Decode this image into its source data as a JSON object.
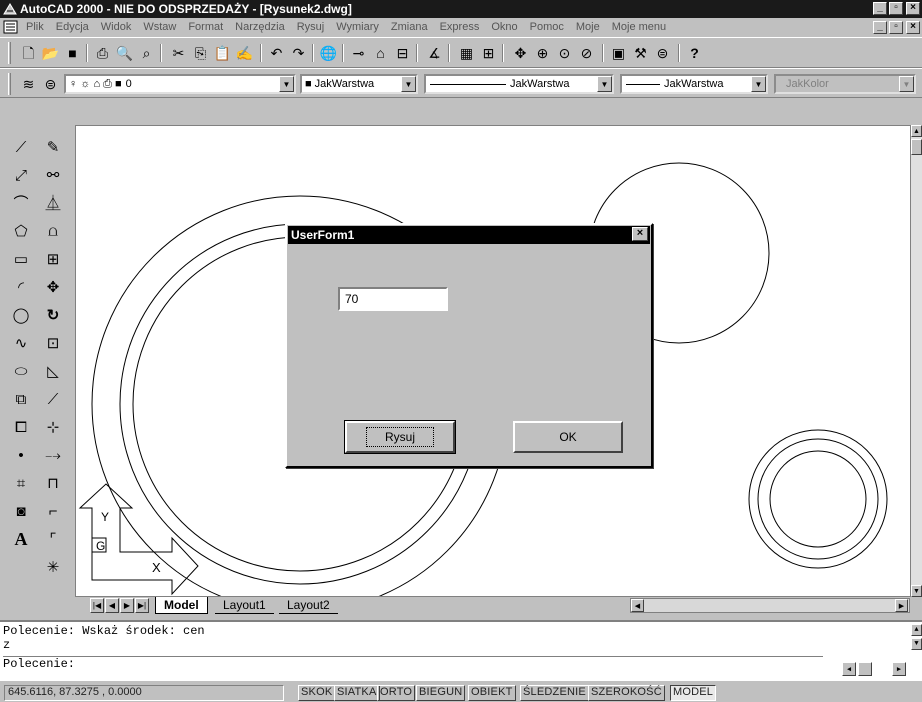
{
  "window": {
    "title": "AutoCAD 2000 - NIE DO ODSPRZEDAŻY - [Rysunek2.dwg]",
    "controls": [
      "_",
      "□",
      "×"
    ]
  },
  "menubar": {
    "items": [
      "Plik",
      "Edycja",
      "Widok",
      "Wstaw",
      "Format",
      "Narzędzia",
      "Rysuj",
      "Wymiary",
      "Zmiana",
      "Express",
      "Okno",
      "Pomoc",
      "Moje",
      "Moje menu"
    ]
  },
  "standard_toolbar": {
    "icons": [
      "new-icon",
      "open-icon",
      "save-icon",
      "print-icon",
      "print-preview-icon",
      "find-icon",
      "cut-icon",
      "copy-icon",
      "paste-icon",
      "match-properties-icon",
      "undo-icon",
      "redo-icon",
      "hyperlink-icon",
      "object-snap-icon",
      "ucs-icon",
      "distance-icon",
      "inquiry-icon",
      "properties-icon",
      "design-center-icon",
      "pan-icon",
      "zoom-realtime-icon",
      "zoom-window-icon",
      "zoom-previous-icon",
      "aerial-view-icon",
      "redraw-icon",
      "help-icon"
    ]
  },
  "layer_toolbar": {
    "layer_value": "0",
    "color_value": "JakWarstwa",
    "linetype_value": "JakWarstwa",
    "lineweight_value": "JakWarstwa",
    "plotstyle_value": "JakKolor"
  },
  "drawing": {
    "ucs_labels": {
      "y": "Y",
      "x": "X",
      "origin": "G"
    }
  },
  "layout_tabs": [
    "Model",
    "Layout1",
    "Layout2"
  ],
  "dialog": {
    "title": "UserForm1",
    "textbox_value": "70",
    "draw_button": "Rysuj",
    "ok_button": "OK",
    "close": "×"
  },
  "command": {
    "line1": "Polecenie: Wskaż środek: cen",
    "line2": "z",
    "line3": "Polecenie:"
  },
  "status": {
    "coords": "645.6116, 87.3275 , 0.0000",
    "toggles": [
      "SKOK",
      "SIATKA",
      "ORTO",
      "BIEGUN",
      "OBIEKT",
      "ŚLEDZENIE",
      "SZEROKOŚĆ",
      "MODEL"
    ]
  }
}
